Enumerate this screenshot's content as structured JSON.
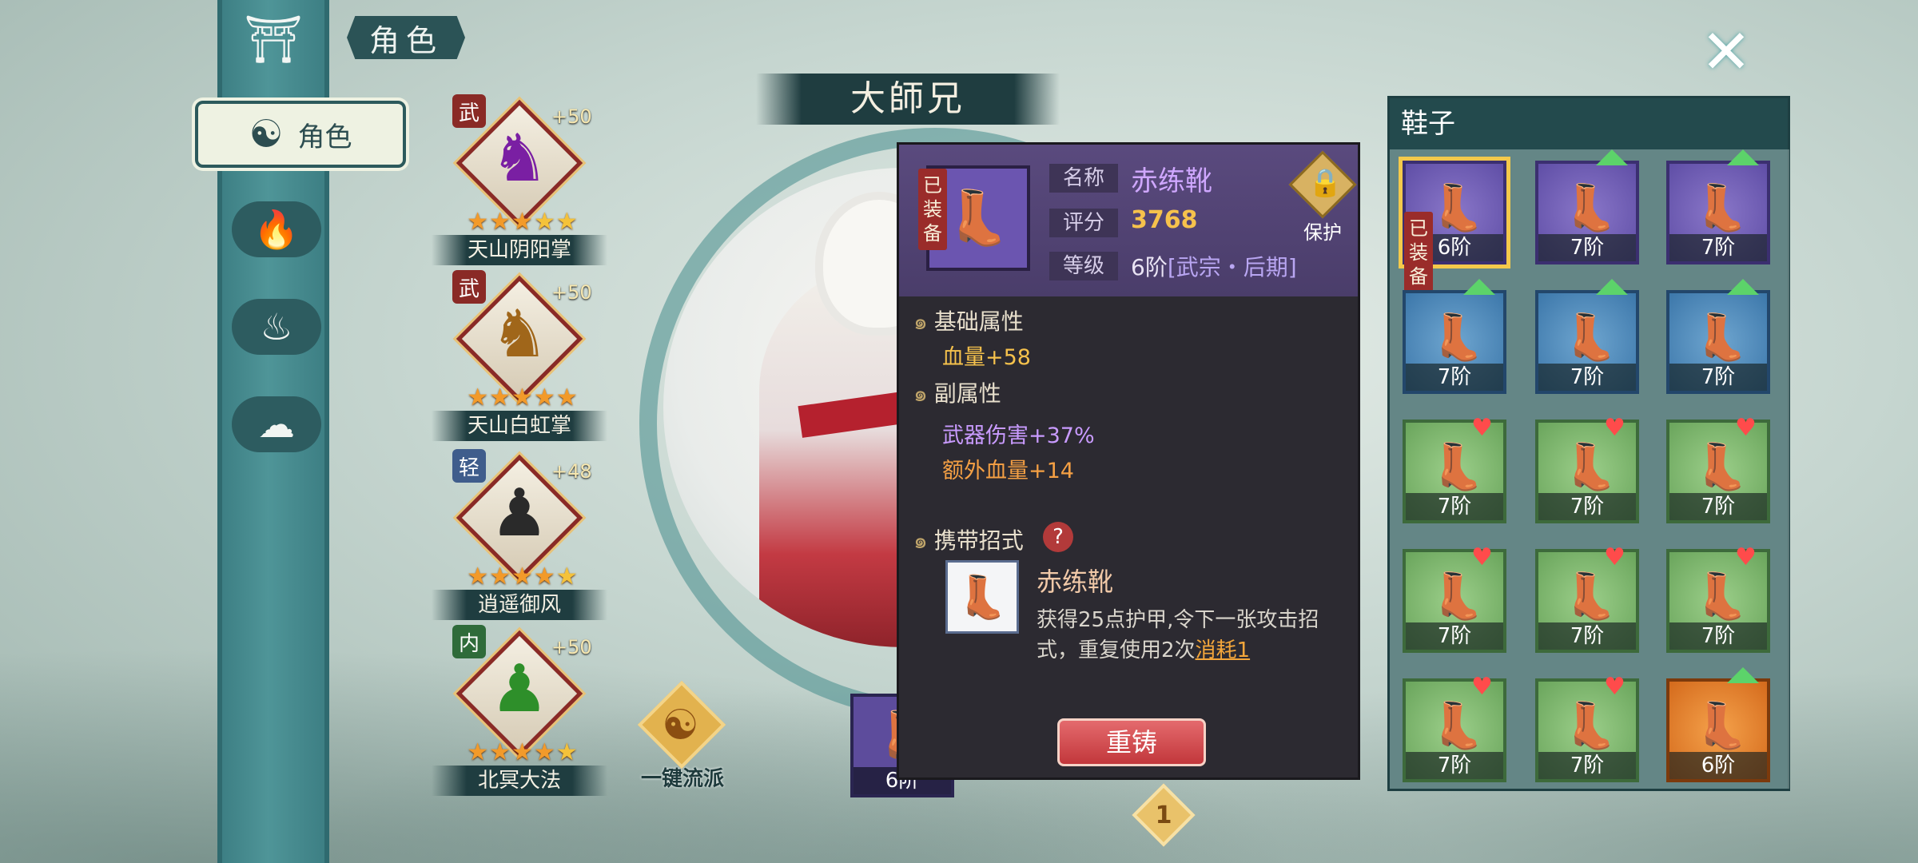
{
  "header": {
    "tab_title": "角色",
    "character_name": "大師兄"
  },
  "nav": {
    "active_label": "角色",
    "items": [
      "character",
      "flame",
      "meditate",
      "pet"
    ]
  },
  "skills": [
    {
      "tag": "武",
      "tag_color": "#8a2a26",
      "bonus": "+50",
      "name": "天山阴阳掌",
      "stars": 5
    },
    {
      "tag": "武",
      "tag_color": "#8a2a26",
      "bonus": "+50",
      "name": "天山白虹掌",
      "stars": 5
    },
    {
      "tag": "轻",
      "tag_color": "#3f5d8c",
      "bonus": "+48",
      "name": "逍遥御风",
      "stars": 5
    },
    {
      "tag": "内",
      "tag_color": "#2f6b3a",
      "bonus": "+50",
      "name": "北冥大法",
      "stars": 5
    }
  ],
  "preset": {
    "label": "一键流派"
  },
  "equipped_slot": {
    "level": "6阶"
  },
  "progress_marker": "1",
  "detail": {
    "equipped_tag": "已装备",
    "name_label": "名称",
    "name": "赤练靴",
    "score_label": "评分",
    "score": "3768",
    "grade_label": "等级",
    "grade": "6阶",
    "rank": "[武宗・后期]",
    "protect": "保护",
    "base_title": "基础属性",
    "base_attr": "血量+58",
    "sub_title": "副属性",
    "sub_attr_1": "武器伤害+37%",
    "sub_attr_2": "额外血量+14",
    "move_title": "携带招式",
    "move_name": "赤练靴",
    "move_desc": "获得25点护甲,令下一张攻击招式，重复使用2次",
    "move_cost": "消耗1",
    "reforge": "重铸"
  },
  "shoes": {
    "title": "鞋子",
    "equipped_tag": "已装备",
    "items": [
      {
        "level": "6阶",
        "rarity": "purple",
        "mark": "none",
        "selected": true
      },
      {
        "level": "7阶",
        "rarity": "purple",
        "mark": "up"
      },
      {
        "level": "7阶",
        "rarity": "purple",
        "mark": "up"
      },
      {
        "level": "7阶",
        "rarity": "blue",
        "mark": "up"
      },
      {
        "level": "7阶",
        "rarity": "blue",
        "mark": "up"
      },
      {
        "level": "7阶",
        "rarity": "blue",
        "mark": "up"
      },
      {
        "level": "7阶",
        "rarity": "green",
        "mark": "down"
      },
      {
        "level": "7阶",
        "rarity": "green",
        "mark": "down"
      },
      {
        "level": "7阶",
        "rarity": "green",
        "mark": "down"
      },
      {
        "level": "7阶",
        "rarity": "green",
        "mark": "down"
      },
      {
        "level": "7阶",
        "rarity": "green",
        "mark": "down"
      },
      {
        "level": "7阶",
        "rarity": "green",
        "mark": "down"
      },
      {
        "level": "7阶",
        "rarity": "green",
        "mark": "down"
      },
      {
        "level": "7阶",
        "rarity": "green",
        "mark": "down"
      },
      {
        "level": "6阶",
        "rarity": "orange",
        "mark": "up"
      }
    ]
  },
  "colors": {
    "accent": "#2f6a6f",
    "gold": "#f6c24c",
    "equip_name": "#cfa7ff"
  }
}
